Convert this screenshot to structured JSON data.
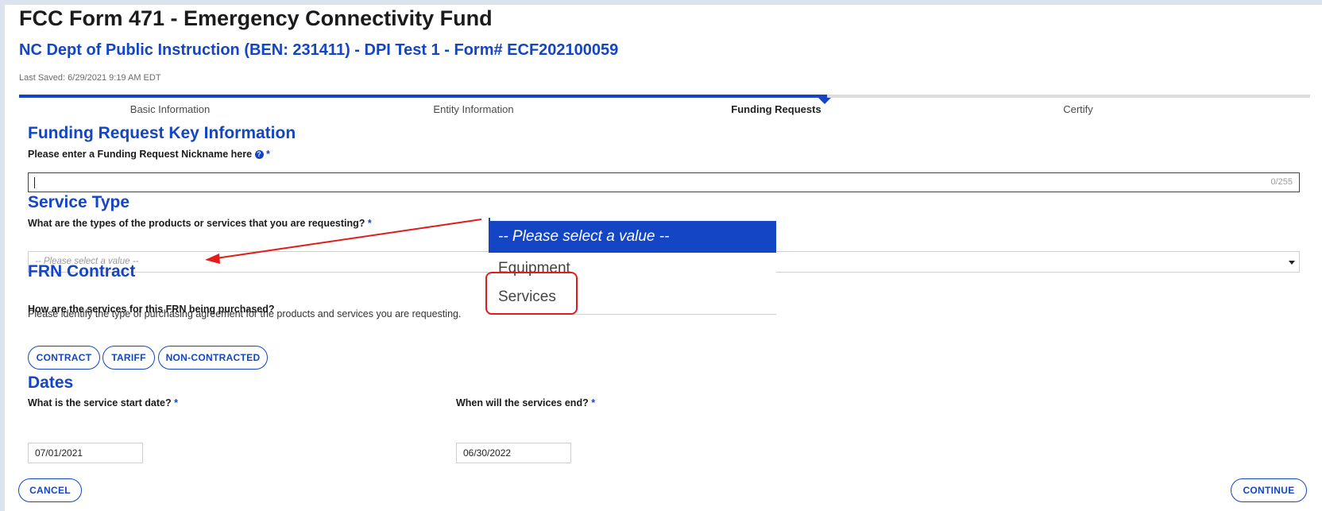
{
  "header": {
    "title": "FCC Form 471 - Emergency Connectivity Fund",
    "subtitle": "NC Dept of Public Instruction (BEN: 231411) - DPI Test 1 - Form# ECF202100059",
    "last_saved": "Last Saved: 6/29/2021 9:19 AM EDT"
  },
  "steps": [
    {
      "label": "Basic Information"
    },
    {
      "label": "Entity Information"
    },
    {
      "label": "Funding Requests"
    },
    {
      "label": "Certify"
    }
  ],
  "progress": {
    "active_step": "Funding Requests",
    "fraction": 0.625
  },
  "key_info": {
    "heading": "Funding Request Key Information",
    "nickname_label": "Please enter a Funding Request Nickname here",
    "required_mark": "*",
    "nickname_value": "",
    "counter": "0/255"
  },
  "service_type": {
    "heading": "Service Type",
    "question": "What are the types of the products or services that you are requesting?",
    "required_mark": "*",
    "placeholder": "-- Please select a value --",
    "options": [
      {
        "label": "-- Please select a value --"
      },
      {
        "label": "Equipment"
      },
      {
        "label": "Services"
      }
    ]
  },
  "contract": {
    "heading": "FRN Contract",
    "description": "Please identify the type of purchasing agreement for the products and services you are requesting.",
    "question": "How are the services for this FRN being purchased?",
    "buttons": [
      {
        "label": "CONTRACT"
      },
      {
        "label": "TARIFF"
      },
      {
        "label": "NON-CONTRACTED"
      }
    ]
  },
  "dates": {
    "heading": "Dates",
    "start_label": "What is the service start date?",
    "start_value": "07/01/2021",
    "end_label": "When will the services end?",
    "end_value": "06/30/2022",
    "required_mark": "*"
  },
  "actions": {
    "cancel": "CANCEL",
    "continue": "CONTINUE"
  },
  "colors": {
    "accent": "#1345c4",
    "annotation": "#e31b1b"
  },
  "icons": {
    "help": "question-circle-icon",
    "select_arrow": "caret-down-icon"
  }
}
